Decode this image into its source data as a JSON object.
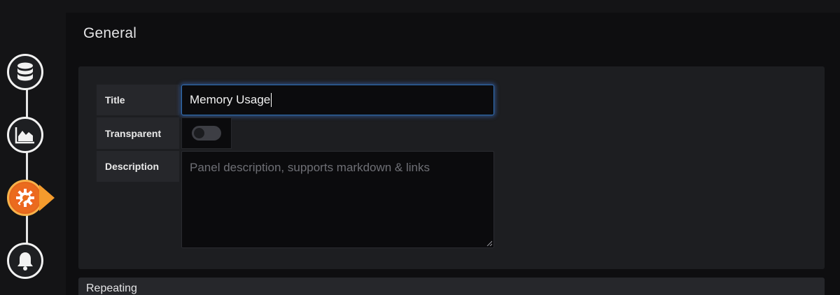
{
  "rail": {
    "steps": [
      {
        "icon": "database-icon",
        "state": "done"
      },
      {
        "icon": "area-chart-icon",
        "state": "done"
      },
      {
        "icon": "wrench-gear-icon",
        "state": "active"
      },
      {
        "icon": "bell-icon",
        "state": "pending"
      }
    ],
    "accent_color": "#f15a24"
  },
  "general": {
    "section_title": "General",
    "title_label": "Title",
    "title_value": "Memory Usage",
    "transparent_label": "Transparent",
    "transparent_on": false,
    "description_label": "Description",
    "description_placeholder": "Panel description, supports markdown & links",
    "description_value": ""
  },
  "repeating": {
    "section_title": "Repeating"
  },
  "colors": {
    "focus_border": "#2f6fb5",
    "panel_bg": "#1d1e21"
  }
}
